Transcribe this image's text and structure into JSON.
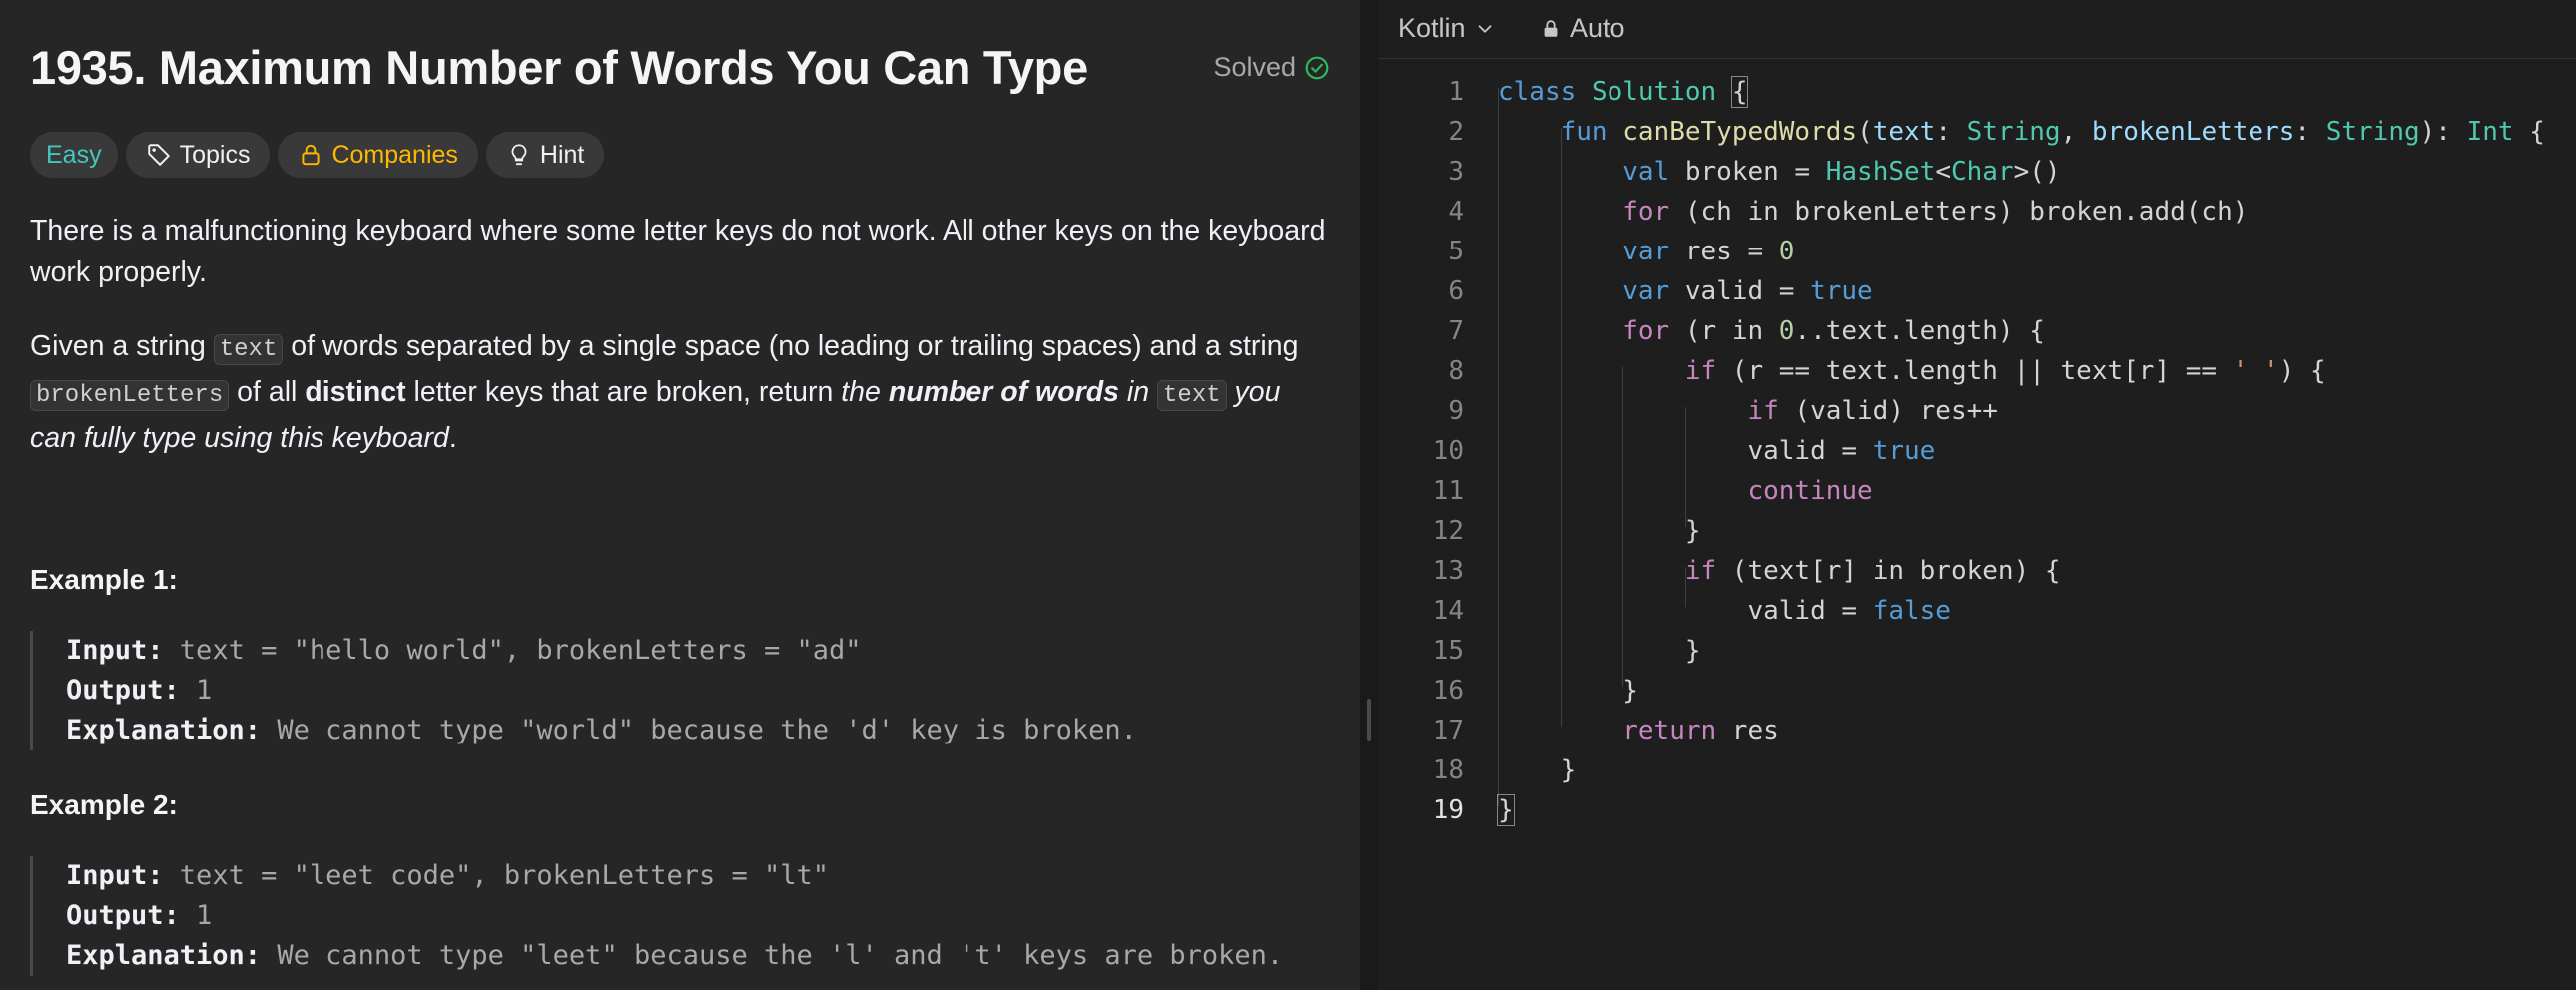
{
  "problem": {
    "title": "1935. Maximum Number of Words You Can Type",
    "status": "Solved",
    "tags": {
      "difficulty": "Easy",
      "topics": "Topics",
      "companies": "Companies",
      "hint": "Hint"
    },
    "paragraph1": "There is a malfunctioning keyboard where some letter keys do not work. All other keys on the keyboard work properly.",
    "paragraph2": {
      "p1": "Given a string ",
      "code1": "text",
      "p2": " of words separated by a single space (no leading or trailing spaces) and a string ",
      "code2": "brokenLetters",
      "p3": " of all ",
      "bold1": "distinct",
      "p4": " letter keys that are broken, return ",
      "i1": "the ",
      "bi1": "number of words",
      "i2": " in ",
      "code3": "text",
      "i3": " you can fully type using this keyboard",
      "p5": "."
    },
    "examples": [
      {
        "heading": "Example 1:",
        "input_label": "Input:",
        "input_value": " text = \"hello world\", brokenLetters = \"ad\"",
        "output_label": "Output:",
        "output_value": " 1",
        "explanation_label": "Explanation:",
        "explanation_value": " We cannot type \"world\" because the 'd' key is broken."
      },
      {
        "heading": "Example 2:",
        "input_label": "Input:",
        "input_value": " text = \"leet code\", brokenLetters = \"lt\"",
        "output_label": "Output:",
        "output_value": " 1",
        "explanation_label": "Explanation:",
        "explanation_value": " We cannot type \"leet\" because the 'l' and 't' keys are broken."
      }
    ]
  },
  "editor": {
    "language": "Kotlin",
    "mode": "Auto",
    "line_numbers": [
      "1",
      "2",
      "3",
      "4",
      "5",
      "6",
      "7",
      "8",
      "9",
      "10",
      "11",
      "12",
      "13",
      "14",
      "15",
      "16",
      "17",
      "18",
      "19"
    ],
    "code_lines": [
      "class Solution {",
      "    fun canBeTypedWords(text: String, brokenLetters: String): Int {",
      "        val broken = HashSet<Char>()",
      "        for (ch in brokenLetters) broken.add(ch)",
      "        var res = 0",
      "        var valid = true",
      "        for (r in 0..text.length) {",
      "            if (r == text.length || text[r] == ' ') {",
      "                if (valid) res++",
      "                valid = true",
      "                continue",
      "            }",
      "            if (text[r] in broken) {",
      "                valid = false",
      "            }",
      "        }",
      "        return res",
      "    }",
      "}"
    ]
  },
  "colors": {
    "easy": "#46c6c2",
    "companies": "#ffb800",
    "solved_check": "#2cbb5d",
    "keyword": "#569cd6",
    "control": "#c586c0",
    "type": "#4ec9b0",
    "function": "#dcdcaa",
    "param": "#9cdcfe",
    "number": "#b5cea8",
    "string": "#ce9178"
  },
  "icons": {
    "solved": "check-circle-icon",
    "topics": "tag-icon",
    "companies": "lock-icon",
    "hint": "lightbulb-icon",
    "language_dropdown": "chevron-down-icon",
    "auto": "lock-icon"
  }
}
